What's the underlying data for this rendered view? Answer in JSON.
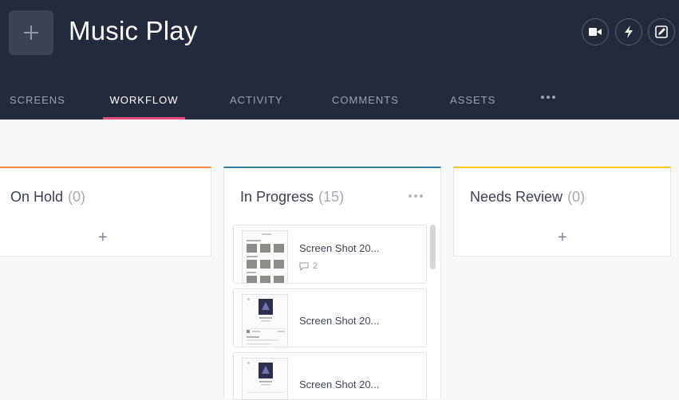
{
  "project": {
    "title": "Music Play",
    "add_icon": "plus-icon"
  },
  "header_buttons": [
    {
      "name": "record-button",
      "icon": "video-camera-icon"
    },
    {
      "name": "flash-button",
      "icon": "lightning-icon"
    },
    {
      "name": "edit-button",
      "icon": "edit-icon"
    }
  ],
  "tabs": [
    {
      "label": "SCREENS",
      "active": false
    },
    {
      "label": "WORKFLOW",
      "active": true
    },
    {
      "label": "ACTIVITY",
      "active": false
    },
    {
      "label": "COMMENTS",
      "active": false
    },
    {
      "label": "ASSETS",
      "active": false
    }
  ],
  "colors": {
    "accent": "#e74b7a",
    "header_bg": "#222a3c",
    "on_hold": "#f08a3c",
    "in_progress": "#2e7ea3",
    "needs_review": "#f3c623"
  },
  "columns": [
    {
      "title": "On Hold",
      "count": "(0)",
      "add_label": "+"
    },
    {
      "title": "In Progress",
      "count": "(15)"
    },
    {
      "title": "Needs Review",
      "count": "(0)",
      "add_label": "+"
    }
  ],
  "cards": [
    {
      "title": "Screen Shot 20...",
      "comments": "2"
    },
    {
      "title": "Screen Shot 20..."
    },
    {
      "title": "Screen Shot 20..."
    }
  ]
}
